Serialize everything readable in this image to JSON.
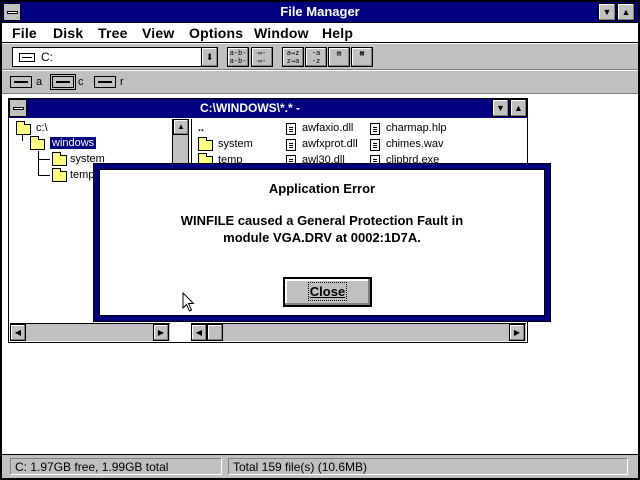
{
  "window": {
    "title": "File Manager",
    "minimize_glyph": "▼",
    "maximize_glyph": "▲"
  },
  "menu": {
    "items": [
      {
        "label": "File"
      },
      {
        "label": "Disk"
      },
      {
        "label": "Tree"
      },
      {
        "label": "View"
      },
      {
        "label": "Options"
      },
      {
        "label": "Window"
      },
      {
        "label": "Help"
      }
    ]
  },
  "toolbar": {
    "drive_value": "C:",
    "dropdown_glyph": "⬇",
    "buttons": [
      {
        "name": "view-by-name-button",
        "glyph": "a-b-\na-b-"
      },
      {
        "name": "view-all-details-button",
        "glyph": "▭-\n▭-"
      },
      {
        "name": "sort-by-name-button",
        "glyph": "a→z\nz→a"
      },
      {
        "name": "sort-by-type-button",
        "glyph": "-a\n-z"
      },
      {
        "name": "sort-by-size-button",
        "glyph": "▤"
      },
      {
        "name": "sort-by-date-button",
        "glyph": "▦"
      }
    ]
  },
  "drives": [
    {
      "letter": "a",
      "selected": false
    },
    {
      "letter": "c",
      "selected": true
    },
    {
      "letter": "r",
      "selected": false
    }
  ],
  "child_window": {
    "title": "C:\\WINDOWS\\*.* -",
    "tree": [
      {
        "label": "c:\\",
        "selected": false
      },
      {
        "label": "windows",
        "selected": true
      },
      {
        "label": "system",
        "selected": false
      },
      {
        "label": "temp",
        "selected": false
      }
    ],
    "up_dir": "..",
    "files": [
      {
        "name": "system",
        "type": "folder"
      },
      {
        "name": "temp",
        "type": "folder"
      },
      {
        "name": "awfaxio.dll",
        "type": "file"
      },
      {
        "name": "awfxprot.dll",
        "type": "file"
      },
      {
        "name": "awl30.dll",
        "type": "file"
      },
      {
        "name": "charmap.hlp",
        "type": "file"
      },
      {
        "name": "chimes.wav",
        "type": "file"
      },
      {
        "name": "clipbrd.exe",
        "type": "file"
      }
    ]
  },
  "dialog": {
    "title": "Application Error",
    "message_line1": "WINFILE caused a General Protection Fault in",
    "message_line2": "module VGA.DRV at 0002:1D7A.",
    "close_label": "Close"
  },
  "status": {
    "disk_free": "C: 1.97GB free,  1.99GB total",
    "file_count": "Total 159 file(s) (10.6MB)"
  }
}
